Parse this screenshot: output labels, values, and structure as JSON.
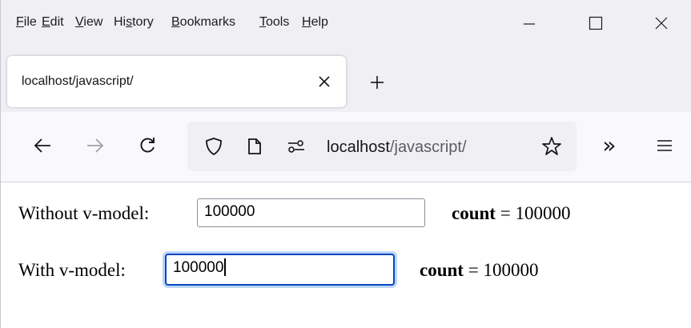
{
  "menu": [
    {
      "pre": "",
      "key": "F",
      "post": "ile"
    },
    {
      "pre": "",
      "key": "E",
      "post": "dit"
    },
    {
      "pre": "",
      "key": "V",
      "post": "iew"
    },
    {
      "pre": "Hi",
      "key": "s",
      "post": "tory"
    },
    {
      "pre": "",
      "key": "B",
      "post": "ookmarks"
    },
    {
      "pre": "",
      "key": "T",
      "post": "ools"
    },
    {
      "pre": "",
      "key": "H",
      "post": "elp"
    }
  ],
  "window_controls": {
    "minimize": "—",
    "maximize": "☐",
    "close": "✕"
  },
  "tab": {
    "title": "localhost/javascript/",
    "close": "✕",
    "new_tab": "+"
  },
  "urlbar": {
    "host": "localhost",
    "path": "/javascript/"
  },
  "nav": {
    "overflow": "»",
    "menu": "≡"
  },
  "rows": [
    {
      "label": "Without v-model:",
      "value": "100000",
      "count_label": "count",
      "count_eq": " = ",
      "count_value": "100000"
    },
    {
      "label": "With v-model:",
      "value": "100000",
      "count_label": "count",
      "count_eq": " = ",
      "count_value": "100000"
    }
  ],
  "colors": {
    "focus_border": "#0a46be",
    "focus_ring": "#bcd5f6",
    "toolbar": "#f9f9fb",
    "chrome": "#f0f0f4"
  }
}
